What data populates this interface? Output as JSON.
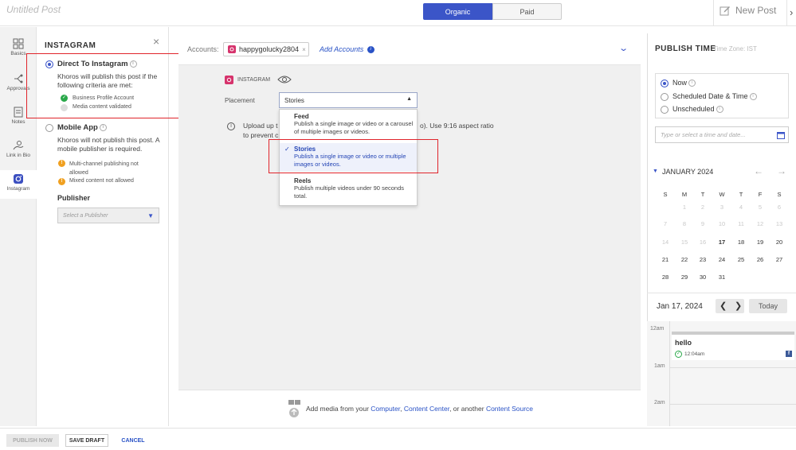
{
  "header": {
    "title": "Untitled Post",
    "tabs": [
      {
        "label": "Organic"
      },
      {
        "label": "Paid"
      }
    ],
    "new_post": "New Post"
  },
  "rail": {
    "items": [
      {
        "label": "Basics",
        "icon": "grid-icon"
      },
      {
        "label": "Approvals",
        "icon": "branch-icon"
      },
      {
        "label": "Notes",
        "icon": "note-icon"
      },
      {
        "label": "Link in Bio",
        "icon": "link-icon"
      },
      {
        "label": "Instagram",
        "icon": "instagram-icon"
      }
    ]
  },
  "panel": {
    "heading": "INSTAGRAM",
    "direct": {
      "title": "Direct To Instagram",
      "desc": "Khoros will publish this post if the following criteria are met:",
      "criteria": [
        "Business Profile Account",
        "Media content validated"
      ]
    },
    "mobile": {
      "title": "Mobile App",
      "desc": "Khoros will not publish this post. A mobile publisher is required.",
      "warnings": [
        "Multi-channel publishing not allowed",
        "Mixed content not allowed"
      ]
    },
    "publisher_label": "Publisher",
    "publisher_placeholder": "Select a Publisher"
  },
  "main": {
    "accounts_label": "Accounts:",
    "account_name": "happygolucky2804",
    "add_accounts": "Add Accounts",
    "network_label": "INSTAGRAM",
    "placement_label": "Placement",
    "placement_value": "Stories",
    "upload_text_start": "Upload up t",
    "upload_text_end": "o). Use 9:16 aspect ratio",
    "upload_text_line2": "to prevent c",
    "menu": [
      {
        "title": "Feed",
        "desc": "Publish a single image or video or a carousel of multiple images or videos."
      },
      {
        "title": "Stories",
        "desc": "Publish a single image or video or multiple images or videos."
      },
      {
        "title": "Reels",
        "desc": "Publish multiple videos under 90 seconds total."
      }
    ],
    "media_prefix": "Add media from your",
    "media_computer": "Computer",
    "media_sep1": ",",
    "media_content_center": "Content Center",
    "media_sep2": ", or another",
    "media_content_source": "Content Source"
  },
  "publish_time": {
    "heading": "PUBLISH TIME",
    "timezone": "Time Zone: IST",
    "options": [
      "Now",
      "Scheduled Date & Time",
      "Unscheduled"
    ],
    "input_placeholder": "Type or select a time and date...",
    "month": "JANUARY 2024",
    "weekdays": [
      "S",
      "M",
      "T",
      "W",
      "T",
      "F",
      "S"
    ],
    "weeks": [
      [
        "",
        "1",
        "2",
        "3",
        "4",
        "5",
        "6"
      ],
      [
        "7",
        "8",
        "9",
        "10",
        "11",
        "12",
        "13"
      ],
      [
        "14",
        "15",
        "16",
        "17",
        "18",
        "19",
        "20"
      ],
      [
        "21",
        "22",
        "23",
        "24",
        "25",
        "26",
        "27"
      ],
      [
        "28",
        "29",
        "30",
        "31",
        "",
        "",
        ""
      ]
    ],
    "selected_date": "Jan 17, 2024",
    "today": "Today",
    "hours": [
      "12am",
      "1am",
      "2am"
    ],
    "event_title": "hello",
    "event_time": "12:04am"
  },
  "footer": {
    "publish_now": "PUBLISH NOW",
    "save_draft": "SAVE DRAFT",
    "cancel": "CANCEL"
  },
  "colors": {
    "accent": "#3b55c8",
    "highlight": "#e0242b",
    "instagram": "#d6336c"
  }
}
